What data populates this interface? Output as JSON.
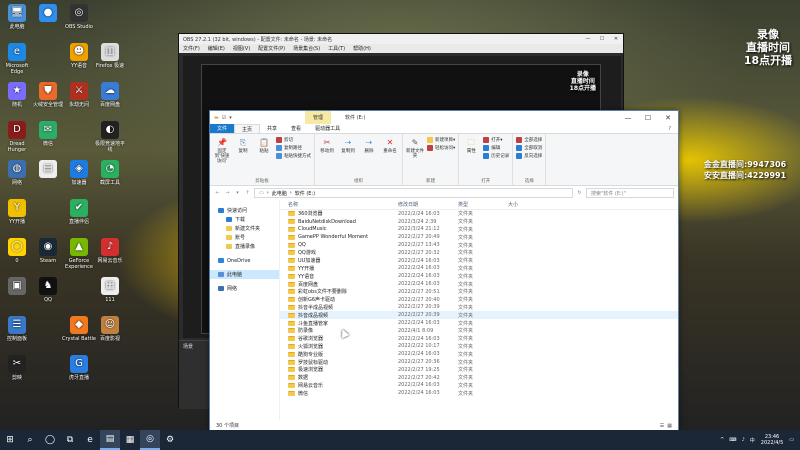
{
  "desktop": {
    "icons": [
      {
        "label": "此电脑",
        "glyph": "🖥",
        "color": "#4a90d9"
      },
      {
        "label": "Microsoft Edge",
        "glyph": "e",
        "color": "#1e88e5"
      },
      {
        "label": "随机",
        "glyph": "★",
        "color": "#7a6cff"
      },
      {
        "label": "Dread Hunger",
        "glyph": "D",
        "color": "#8b1c1c"
      },
      {
        "label": "网络",
        "glyph": "◍",
        "color": "#3b6fb0"
      },
      {
        "label": "YY开播",
        "glyph": "Y",
        "color": "#f0c000"
      },
      {
        "label": "0",
        "glyph": "◯",
        "color": "#ffd400"
      },
      {
        "label": "",
        "glyph": "▣",
        "color": "#666"
      },
      {
        "label": "控制面板",
        "glyph": "☰",
        "color": "#3a78c9"
      },
      {
        "label": "剪映",
        "glyph": "✂",
        "color": "#222"
      },
      {
        "label": "",
        "glyph": "●",
        "color": "#2f8ef0"
      },
      {
        "label": "",
        "glyph": "",
        "color": "rgba(0,0,0,0)"
      },
      {
        "label": "火绒安全管理",
        "glyph": "⛊",
        "color": "#e96a2a"
      },
      {
        "label": "微信",
        "glyph": "✉",
        "color": "#2aae67"
      },
      {
        "label": "",
        "glyph": "▤",
        "color": "#eee"
      },
      {
        "label": "",
        "glyph": "",
        "color": "rgba(0,0,0,0)"
      },
      {
        "label": "Steam",
        "glyph": "◉",
        "color": "#1b2838"
      },
      {
        "label": "QQ",
        "glyph": "♞",
        "color": "#111"
      },
      {
        "label": "",
        "glyph": "",
        "color": "rgba(0,0,0,0)"
      },
      {
        "label": "",
        "glyph": "",
        "color": "rgba(0,0,0,0)"
      },
      {
        "label": "OBS Studio",
        "glyph": "◎",
        "color": "#333"
      },
      {
        "label": "YY语音",
        "glyph": "☻",
        "color": "#f0a000"
      },
      {
        "label": "永劫无间",
        "glyph": "⚔",
        "color": "#b03020"
      },
      {
        "label": "",
        "glyph": "",
        "color": "rgba(0,0,0,0)"
      },
      {
        "label": "加速器",
        "glyph": "◈",
        "color": "#1e7be0"
      },
      {
        "label": "直播伴侣",
        "glyph": "✔",
        "color": "#2ab060"
      },
      {
        "label": "GeForce Experience",
        "glyph": "▲",
        "color": "#76b900"
      },
      {
        "label": "",
        "glyph": "",
        "color": "rgba(0,0,0,0)"
      },
      {
        "label": "Crystal Battle",
        "glyph": "◆",
        "color": "#f07a20"
      },
      {
        "label": "虎牙直播",
        "glyph": "G",
        "color": "#2a7de1"
      },
      {
        "label": "",
        "glyph": "",
        "color": "rgba(0,0,0,0)"
      },
      {
        "label": "Firefox 极速",
        "glyph": "▥",
        "color": "#ddd"
      },
      {
        "label": "百度网盘",
        "glyph": "☁",
        "color": "#3a7bd5"
      },
      {
        "label": "极限竞速地平线",
        "glyph": "◐",
        "color": "#222"
      },
      {
        "label": "截屏工具",
        "glyph": "◔",
        "color": "#2ab060"
      },
      {
        "label": "",
        "glyph": "",
        "color": "rgba(0,0,0,0)"
      },
      {
        "label": "网易云音乐",
        "glyph": "♪",
        "color": "#d32f2f"
      },
      {
        "label": "111",
        "glyph": "▦",
        "color": "#eee"
      },
      {
        "label": "百度影视",
        "glyph": "☺",
        "color": "#c08040"
      },
      {
        "label": "",
        "glyph": "",
        "color": "rgba(0,0,0,0)"
      }
    ],
    "overlay_top": [
      "录像",
      "直播时间",
      "18点开播"
    ],
    "overlay_right": [
      "金金直播间:9947306",
      "安安直播间:4229991"
    ],
    "preview_overlay": [
      "录像",
      "直播时间",
      "18点开播"
    ]
  },
  "obs": {
    "title": "OBS 27.2.1 (32 bit, windows) - 配置文件: 未命名 - 场景: 未命名",
    "menu": [
      "文件(F)",
      "编辑(E)",
      "视图(V)",
      "配置文件(P)",
      "场景集合(S)",
      "工具(T)",
      "帮助(H)"
    ],
    "scene_label": "场景"
  },
  "explorer": {
    "manage_tab": "管理",
    "title": "软件 (E:)",
    "ribbon_tabs": [
      "文件",
      "主页",
      "共享",
      "查看",
      "驱动器工具"
    ],
    "groups": [
      {
        "name": "剪贴板",
        "big": [
          "固定到'快速访问'",
          "复制",
          "粘贴"
        ],
        "small": [
          "剪切",
          "复制路径",
          "粘贴快捷方式"
        ]
      },
      {
        "name": "组织",
        "big": [
          "移动到",
          "复制到",
          "删除",
          "重命名"
        ],
        "small": []
      },
      {
        "name": "新建",
        "big": [
          "新建文件夹"
        ],
        "small": [
          "新建项目▾",
          "轻松访问▾"
        ]
      },
      {
        "name": "打开",
        "big": [
          "属性"
        ],
        "small": [
          "打开▾",
          "编辑",
          "历史记录"
        ]
      },
      {
        "name": "选择",
        "big": [],
        "small": [
          "全部选择",
          "全部取消",
          "反向选择"
        ]
      }
    ],
    "address": [
      "此电脑",
      "软件 (E:)"
    ],
    "search_placeholder": "搜索\"软件 (E:)\"",
    "nav": [
      {
        "label": "快速访问",
        "sub": false,
        "color": "#2b7cd3",
        "sel": false
      },
      {
        "label": "下载",
        "sub": true,
        "color": "#2b7cd3",
        "sel": false
      },
      {
        "label": "新建文件夹",
        "sub": true,
        "color": "#f3c84b",
        "sel": false
      },
      {
        "label": "账号",
        "sub": true,
        "color": "#f3c84b",
        "sel": false
      },
      {
        "label": "直播录像",
        "sub": true,
        "color": "#f3c84b",
        "sel": false
      },
      {
        "label": "OneDrive",
        "sub": false,
        "color": "#2b88d8",
        "sel": false
      },
      {
        "label": "此电脑",
        "sub": false,
        "color": "#5a8fd8",
        "sel": true
      },
      {
        "label": "网络",
        "sub": false,
        "color": "#3b6fb0",
        "sel": false
      }
    ],
    "columns": {
      "name": "名称",
      "date": "修改日期",
      "type": "类型",
      "size": "大小"
    },
    "files": [
      {
        "name": "360浏览器",
        "date": "2022/2/24 16:03",
        "type": "文件夹"
      },
      {
        "name": "BaiduNetdiskDownload",
        "date": "2022/3/24 2:39",
        "type": "文件夹"
      },
      {
        "name": "CloudMusic",
        "date": "2022/3/24 21:12",
        "type": "文件夹"
      },
      {
        "name": "GamePP Wonderful Moment",
        "date": "2022/2/27 20:49",
        "type": "文件夹"
      },
      {
        "name": "QQ",
        "date": "2022/2/27 13:43",
        "type": "文件夹"
      },
      {
        "name": "QQ游戏",
        "date": "2022/2/27 20:32",
        "type": "文件夹"
      },
      {
        "name": "UU加速器",
        "date": "2022/2/24 16:03",
        "type": "文件夹"
      },
      {
        "name": "YY开播",
        "date": "2022/2/24 16:03",
        "type": "文件夹"
      },
      {
        "name": "YY语音",
        "date": "2022/2/24 16:03",
        "type": "文件夹"
      },
      {
        "name": "百度网盘",
        "date": "2022/2/24 16:03",
        "type": "文件夹"
      },
      {
        "name": "彩虹obs文件不要删除",
        "date": "2022/2/27 20:51",
        "type": "文件夹"
      },
      {
        "name": "创新G6声卡驱动",
        "date": "2022/2/27 20:40",
        "type": "文件夹"
      },
      {
        "name": "抖音半成品视频",
        "date": "2022/2/27 20:39",
        "type": "文件夹"
      },
      {
        "name": "抖音成品视频",
        "date": "2022/2/27 20:39",
        "type": "文件夹"
      },
      {
        "name": "斗鱼直播管家",
        "date": "2022/2/24 16:03",
        "type": "文件夹"
      },
      {
        "name": "防录像",
        "date": "2022/4/1 8:09",
        "type": "文件夹"
      },
      {
        "name": "谷歌浏览器",
        "date": "2022/2/24 16:03",
        "type": "文件夹"
      },
      {
        "name": "火狐浏览器",
        "date": "2022/2/22 10:17",
        "type": "文件夹"
      },
      {
        "name": "酷狗专业版",
        "date": "2022/2/24 16:03",
        "type": "文件夹"
      },
      {
        "name": "罗技鼠标驱动",
        "date": "2022/2/27 20:36",
        "type": "文件夹"
      },
      {
        "name": "极速浏览器",
        "date": "2022/2/27 19:25",
        "type": "文件夹"
      },
      {
        "name": "数据",
        "date": "2022/2/27 20:42",
        "type": "文件夹"
      },
      {
        "name": "网易云音乐",
        "date": "2022/2/24 16:03",
        "type": "文件夹"
      },
      {
        "name": "微信",
        "date": "2022/2/24 16:03",
        "type": "文件夹"
      }
    ],
    "status": "30 个项目"
  },
  "taskbar": {
    "icons": [
      "⊞",
      "⌕",
      "◯",
      "⧉",
      "e",
      "▤",
      "▦",
      "◎",
      "⚙"
    ],
    "time": "23:46",
    "date": "2022/4/5",
    "tray": [
      "^",
      "⌨",
      "♪",
      "中"
    ]
  }
}
